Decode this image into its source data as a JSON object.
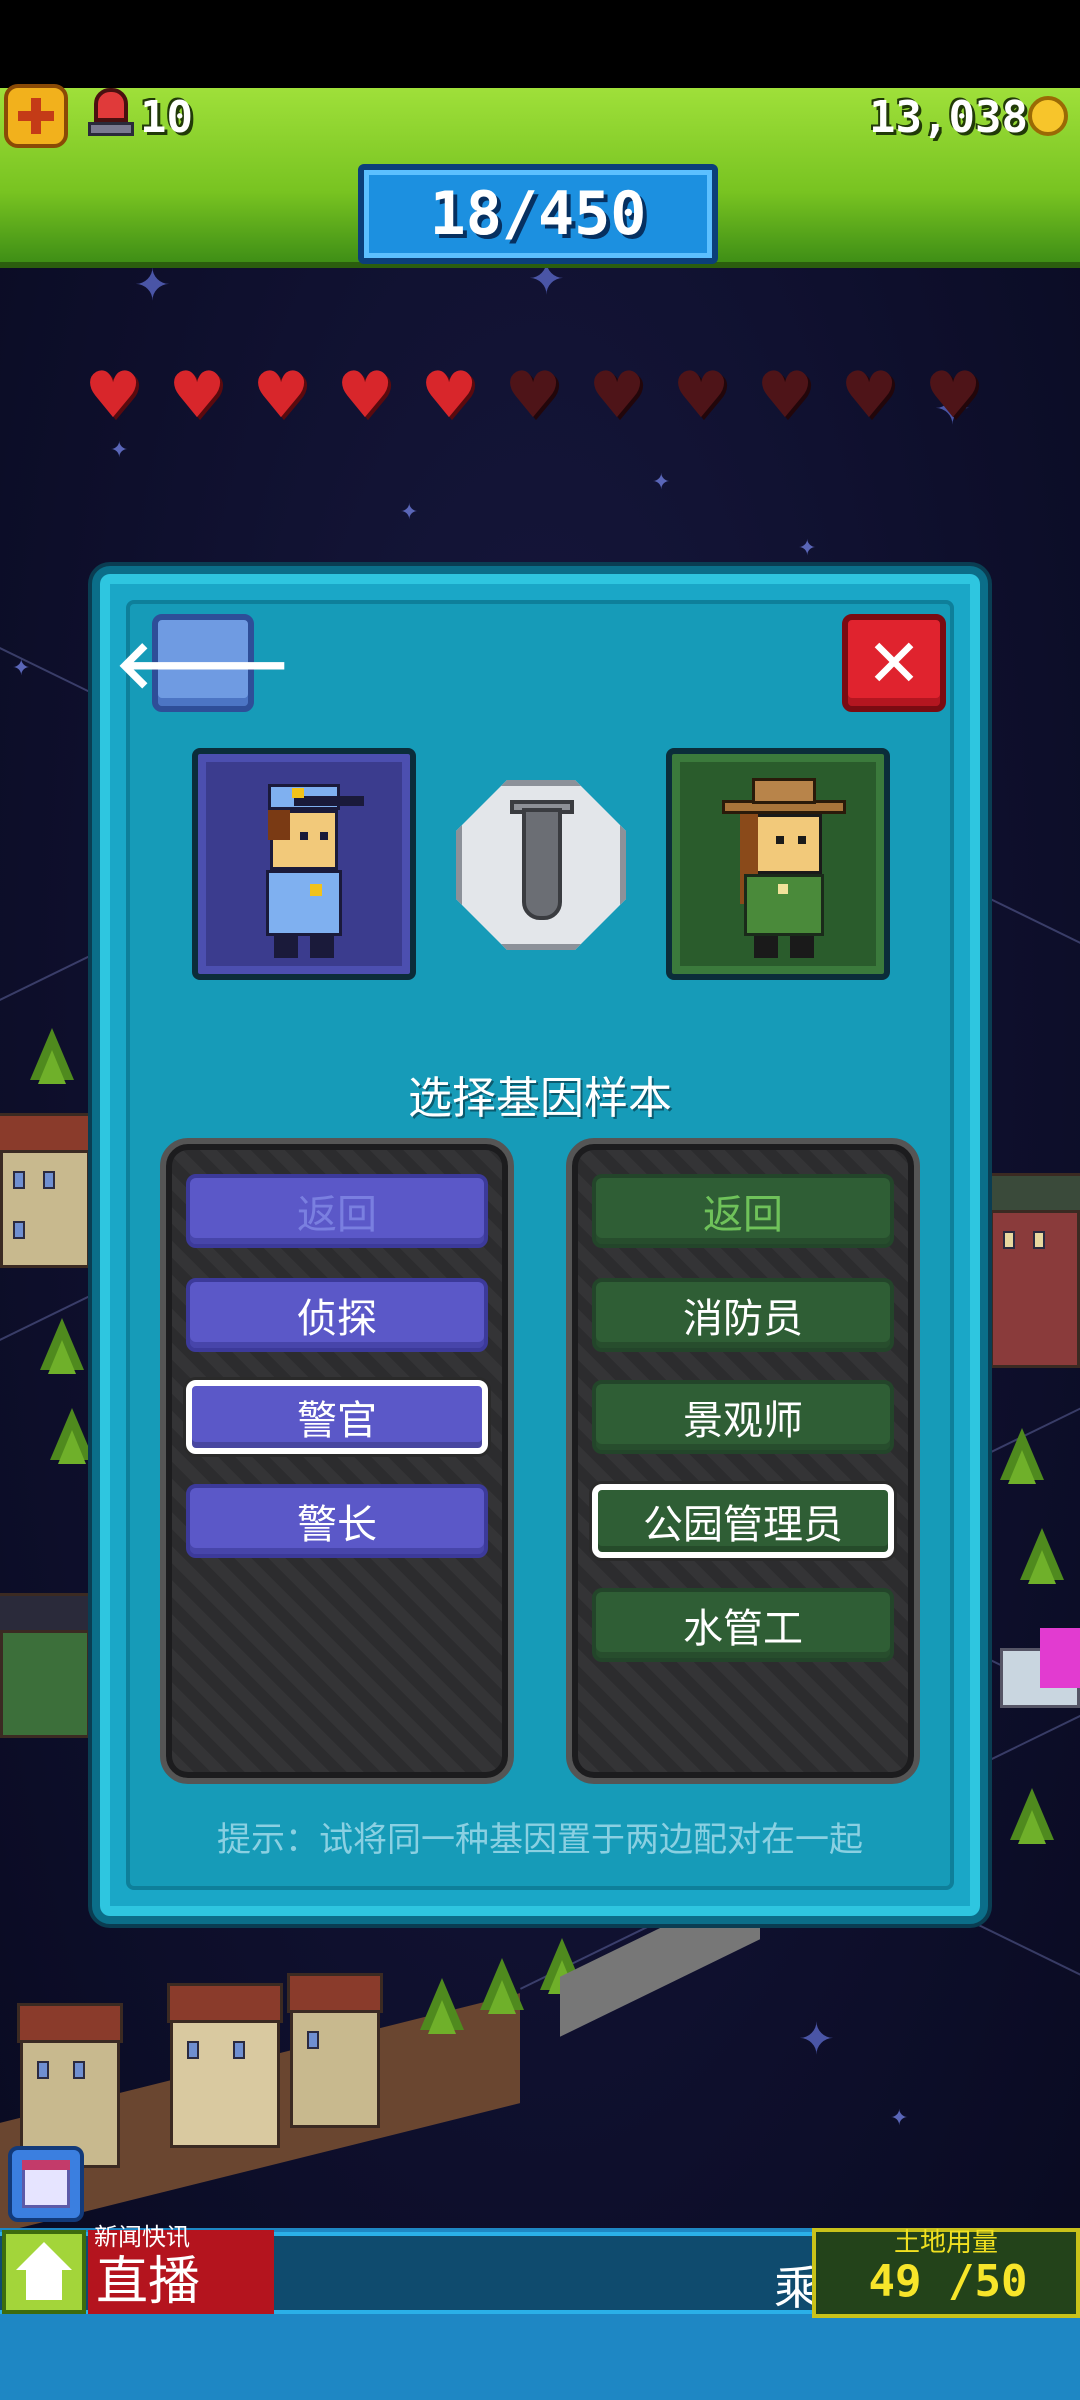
{
  "hud": {
    "siren_count": "10",
    "population": "18/450",
    "coins": "13,038"
  },
  "hearts": {
    "filled": 5,
    "total": 11
  },
  "dialog": {
    "title": "选择基因样本",
    "left_slot": "police-officer-character",
    "right_slot": "park-ranger-character",
    "left_list": {
      "back_label": "返回",
      "items": [
        {
          "label": "侦探",
          "selected": false
        },
        {
          "label": "警官",
          "selected": true
        },
        {
          "label": "警长",
          "selected": false
        }
      ]
    },
    "right_list": {
      "back_label": "返回",
      "items": [
        {
          "label": "消防员",
          "selected": false
        },
        {
          "label": "景观师",
          "selected": false
        },
        {
          "label": "公园管理员",
          "selected": true
        },
        {
          "label": "水管工",
          "selected": false
        }
      ]
    },
    "hint": "提示：试将同一种基因置于两边配对在一起"
  },
  "bottom": {
    "news_label": "新闻快讯",
    "live_label": "直播",
    "ticker_text": "乘",
    "land_label": "土地用量",
    "land_usage": "49 /50"
  },
  "colors": {
    "hud_green": "#78c321",
    "population_blue": "#1c90e0",
    "dialog_teal": "#1aa7c7",
    "heart_red": "#d8262b",
    "option_blue": "#5b58c8",
    "option_green": "#2f5e35"
  }
}
